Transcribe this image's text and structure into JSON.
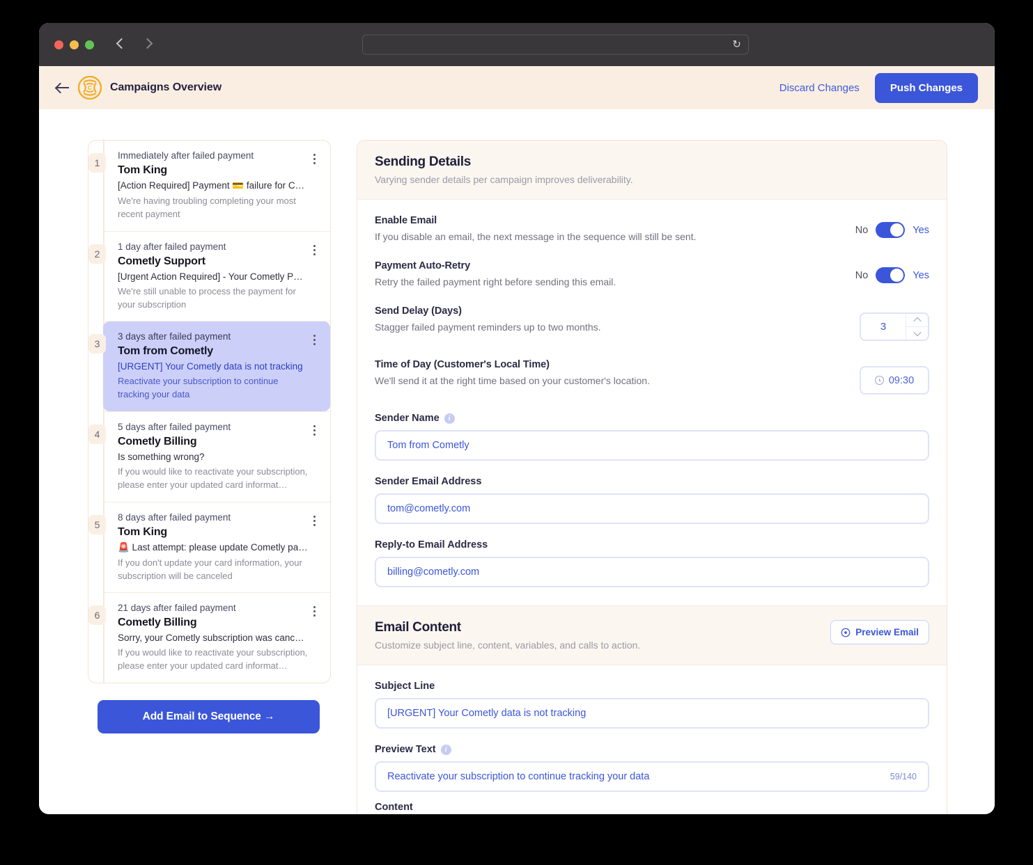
{
  "browser": {
    "url_value": "",
    "url_placeholder": "",
    "reload_icon": "reload-icon",
    "back_icon": "chevron-left-icon",
    "forward_icon": "chevron-right-icon"
  },
  "header": {
    "back_icon": "arrow-left-icon",
    "logo_icon": "cometly-logo-icon",
    "title": "Campaigns Overview",
    "discard_label": "Discard Changes",
    "push_label": "Push Changes",
    "accent_blue": "#3b56d9",
    "header_bg": "#faeee3"
  },
  "sequence": {
    "add_button_label": "Add Email to Sequence →",
    "items": [
      {
        "number": "1",
        "when": "Immediately after failed payment",
        "sender": "Tom King",
        "subject": "[Action Required] Payment 💳 failure for Cometly",
        "preview": "We're having troubling completing your most recent payment",
        "selected": false
      },
      {
        "number": "2",
        "when": "1 day after failed payment",
        "sender": "Cometly Support",
        "subject": "[Urgent Action Required] - Your Cometly Payment H…",
        "preview": "We're still unable to process the payment for your subscription",
        "selected": false
      },
      {
        "number": "3",
        "when": "3 days after failed payment",
        "sender": "Tom from Cometly",
        "subject": "[URGENT] Your Cometly data is not tracking",
        "preview": "Reactivate your subscription to continue tracking your data",
        "selected": true
      },
      {
        "number": "4",
        "when": "5 days after failed payment",
        "sender": "Cometly Billing",
        "subject": "Is something wrong?",
        "preview": "If you would like to reactivate your subscription, please enter your updated card informat…",
        "selected": false
      },
      {
        "number": "5",
        "when": "8 days after failed payment",
        "sender": "Tom King",
        "subject": "🚨 Last attempt: please update Cometly payment …",
        "preview": "If you don't update your card information, your subscription will be canceled",
        "selected": false
      },
      {
        "number": "6",
        "when": "21 days after failed payment",
        "sender": "Cometly Billing",
        "subject": "Sorry, your Cometly subscription was cancelled",
        "preview": "If you would like to reactivate your subscription, please enter your updated card informat…",
        "selected": false
      }
    ]
  },
  "sending_details": {
    "title": "Sending Details",
    "subtitle": "Varying sender details per campaign improves deliverability.",
    "enable_email": {
      "label": "Enable Email",
      "desc": "If you disable an email, the next message in the sequence will still be sent.",
      "off_label": "No",
      "on_label": "Yes",
      "value": "Yes"
    },
    "auto_retry": {
      "label": "Payment Auto-Retry",
      "desc": "Retry the failed payment right before sending this email.",
      "off_label": "No",
      "on_label": "Yes",
      "value": "Yes"
    },
    "send_delay": {
      "label": "Send Delay (Days)",
      "desc": "Stagger failed payment reminders up to two months.",
      "value": "3"
    },
    "time_of_day": {
      "label": "Time of Day (Customer's Local Time)",
      "desc": "We'll send it at the right time based on your customer's location.",
      "value": "09:30",
      "icon": "clock-icon"
    },
    "sender_name": {
      "label": "Sender Name",
      "value": "Tom from Cometly",
      "info_icon": "info-icon"
    },
    "sender_email": {
      "label": "Sender Email Address",
      "value": "tom@cometly.com"
    },
    "reply_to": {
      "label": "Reply-to Email Address",
      "value": "billing@cometly.com"
    }
  },
  "email_content": {
    "title": "Email Content",
    "subtitle": "Customize subject line, content, variables, and calls to action.",
    "preview_button": "Preview Email",
    "preview_icon": "eye-icon",
    "subject_line": {
      "label": "Subject Line",
      "value": "[URGENT] Your Cometly data is not tracking"
    },
    "preview_text": {
      "label": "Preview Text",
      "value": "Reactivate your subscription to continue tracking your data",
      "counter": "59/140",
      "info_icon": "info-icon"
    },
    "next_section_label": "Content"
  }
}
